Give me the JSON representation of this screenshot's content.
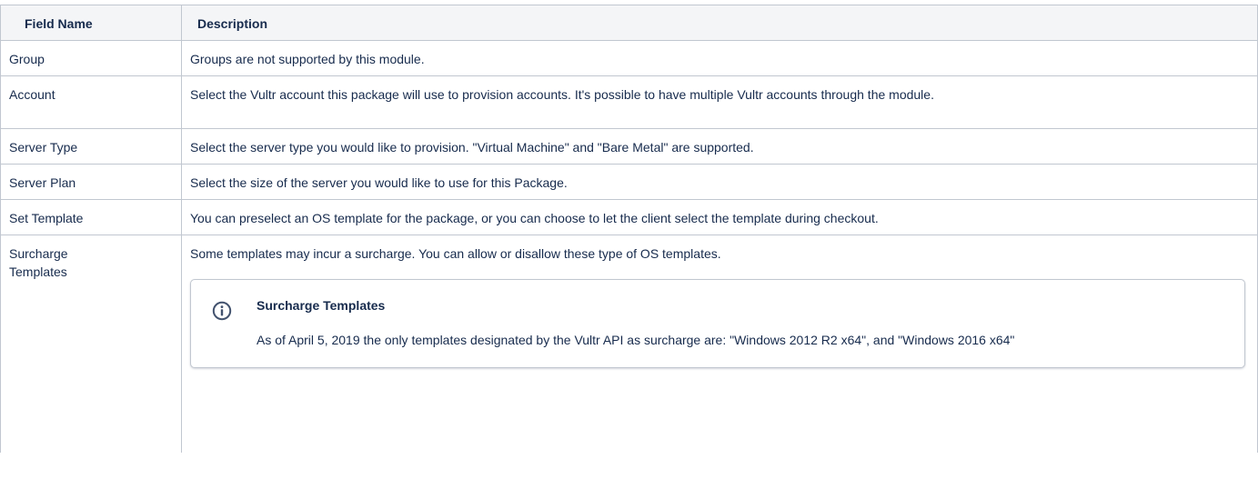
{
  "table": {
    "headers": {
      "name": "Field Name",
      "description": "Description"
    },
    "rows": [
      {
        "name": "Group",
        "description": "Groups are not supported by this module."
      },
      {
        "name": "Account",
        "description": "Select the Vultr account this package will use to provision accounts. It's possible to have multiple Vultr accounts through the module."
      },
      {
        "name": "Server Type",
        "description": "Select the server type you would like to provision. \"Virtual Machine\" and \"Bare Metal\" are supported."
      },
      {
        "name": "Server Plan",
        "description": "Select the size of the server you would like to use for this Package."
      },
      {
        "name": "Set Template",
        "description": "You can preselect an OS template for the package, or you can choose to let the client select the template during checkout."
      },
      {
        "name": "Surcharge Templates",
        "description": "Some templates may incur a surcharge. You can allow or disallow these type of OS templates."
      }
    ]
  },
  "info_panel": {
    "icon": "info-icon",
    "title": "Surcharge Templates",
    "body": "As of April 5, 2019 the only templates designated by the Vultr API as surcharge are: \"Windows 2012 R2 x64\", and \"Windows 2016 x64\""
  },
  "colors": {
    "border": "#c1c7d0",
    "header_bg": "#f4f5f7",
    "text": "#172b4d",
    "icon": "#42526e"
  }
}
